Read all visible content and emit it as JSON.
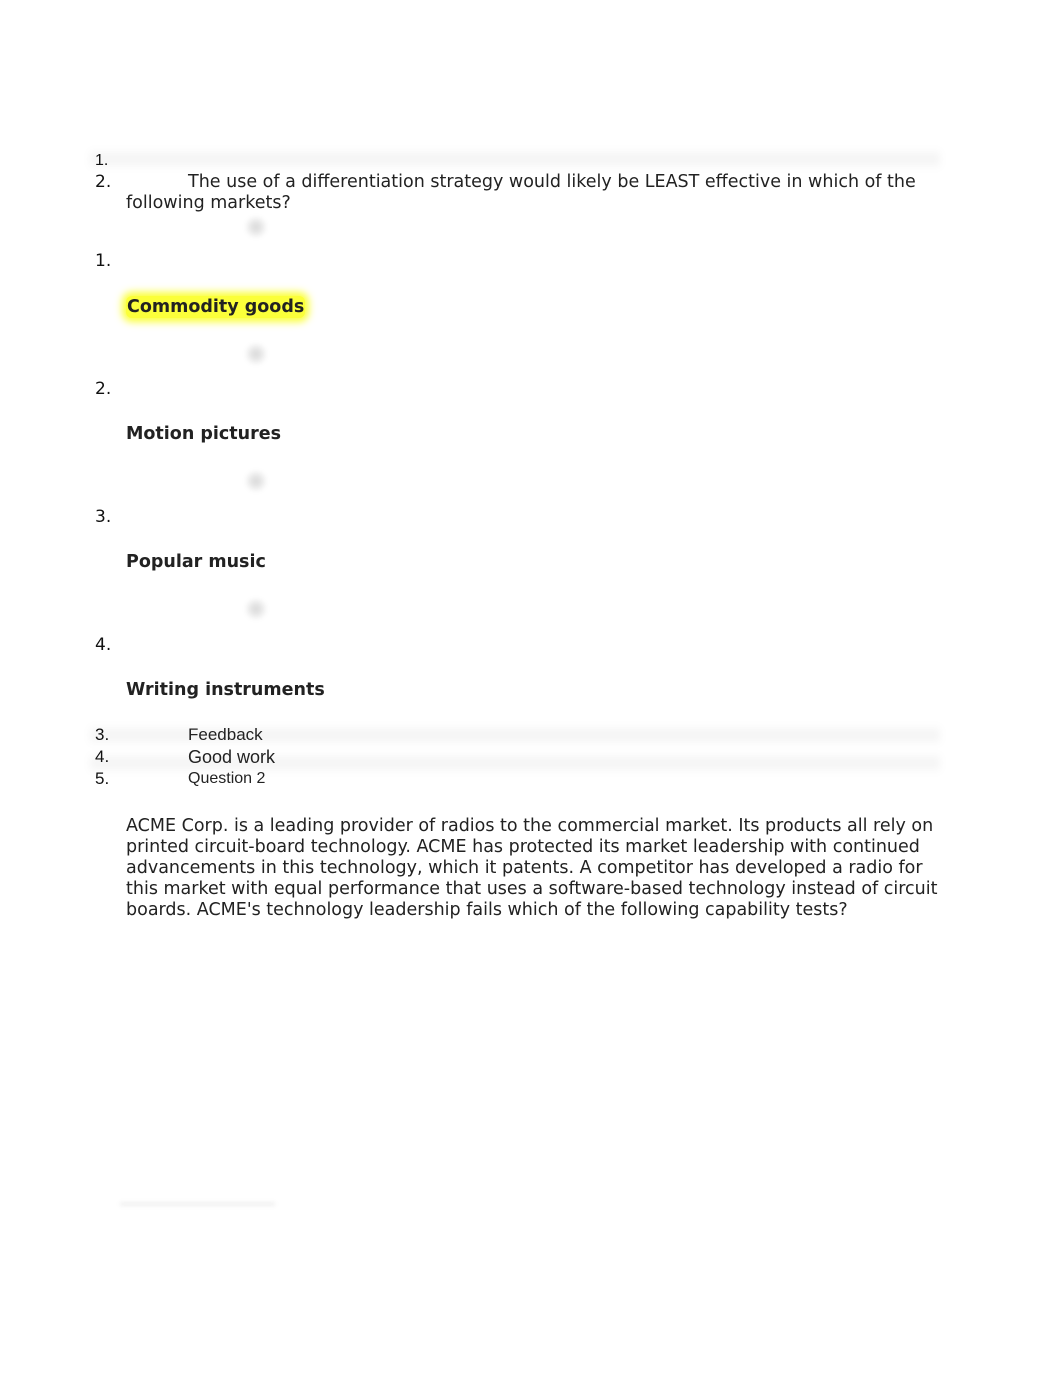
{
  "question1": {
    "empty_item_number": "1.",
    "number": "2.",
    "prompt": "The use of a differentiation strategy would likely be LEAST effective in which of the following markets?",
    "options": [
      {
        "number": "1.",
        "label": "Commodity goods",
        "selected": true,
        "icon": "radio-button-icon"
      },
      {
        "number": "2.",
        "label": "Motion pictures",
        "selected": false,
        "icon": "radio-button-icon"
      },
      {
        "number": "3.",
        "label": "Popular music",
        "selected": false,
        "icon": "radio-button-icon"
      },
      {
        "number": "4.",
        "label": "Writing instruments",
        "selected": false,
        "icon": "radio-button-icon"
      }
    ],
    "highlight_color": "#fbff3a"
  },
  "feedback": {
    "number": "3.",
    "label": "Feedback"
  },
  "feedback_text": {
    "number": "4.",
    "label": "Good work"
  },
  "question2": {
    "number": "5.",
    "label": "Question 2",
    "prompt": "ACME Corp. is a leading provider of radios to the commercial market. Its products all rely on printed circuit-board technology. ACME has protected its market leadership with continued advancements in this technology, which it patents. A competitor has developed a radio for this market with equal performance that uses a software-based technology instead of circuit boards. ACME's technology leadership fails which of the following capability tests?"
  }
}
